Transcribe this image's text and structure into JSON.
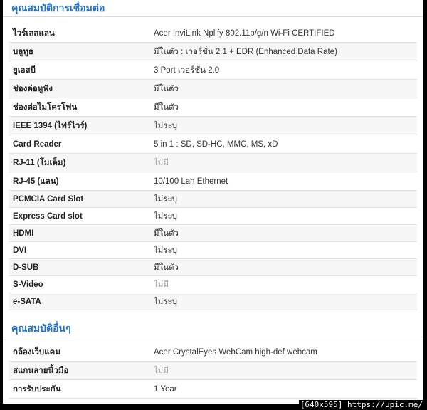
{
  "sections": [
    {
      "title": "คุณสมบัติการเชื่อมต่อ",
      "rows": [
        {
          "label": "ไวร์เลสแลน",
          "value": "Acer InviLink Nplify 802.11b/g/n Wi-Fi CERTIFIED",
          "na": false
        },
        {
          "label": "บลูทูธ",
          "value": "มีในตัว : เวอร์ชั่น 2.1 + EDR (Enhanced Data Rate)",
          "na": false
        },
        {
          "label": "ยูเอสบี",
          "value": "3 Port เวอร์ชั่น 2.0",
          "na": false
        },
        {
          "label": "ช่องต่อหูฟัง",
          "value": "มีในตัว",
          "na": false
        },
        {
          "label": "ช่องต่อไมโครโฟน",
          "value": "มีในตัว",
          "na": false
        },
        {
          "label": "IEEE 1394 (ไฟร์ไวร์)",
          "value": "ไม่ระบุ",
          "na": false
        },
        {
          "label": "Card Reader",
          "value": "5 in 1 : SD, SD-HC, MMC, MS, xD",
          "na": false
        },
        {
          "label": "RJ-11 (โมเด็ม)",
          "value": "ไม่มี",
          "na": true
        },
        {
          "label": "RJ-45 (แลน)",
          "value": "10/100 Lan Ethernet",
          "na": false
        },
        {
          "label": "PCMCIA Card Slot",
          "value": "ไม่ระบุ",
          "na": false
        },
        {
          "label": "Express Card slot",
          "value": "ไม่ระบุ",
          "na": false
        },
        {
          "label": "HDMI",
          "value": "มีในตัว",
          "na": false
        },
        {
          "label": "DVI",
          "value": "ไม่ระบุ",
          "na": false
        },
        {
          "label": "D-SUB",
          "value": "มีในตัว",
          "na": false
        },
        {
          "label": "S-Video",
          "value": "ไม่มี",
          "na": true
        },
        {
          "label": "e-SATA",
          "value": "ไม่ระบุ",
          "na": false
        }
      ]
    },
    {
      "title": "คุณสมบัติอื่นๆ",
      "rows": [
        {
          "label": "กล้องเว็บแคม",
          "value": "Acer CrystalEyes WebCam high-def webcam",
          "na": false
        },
        {
          "label": "สแกนลายนิ้วมือ",
          "value": "ไม่มี",
          "na": true
        },
        {
          "label": "การรับประกัน",
          "value": "1 Year",
          "na": false
        }
      ]
    }
  ],
  "watermark": "[640x595] https://upic.me/",
  "colors": {
    "section_title": "#1f6fc4",
    "na_text": "#9a9a9a",
    "row_alt": "#f6f6f6"
  }
}
